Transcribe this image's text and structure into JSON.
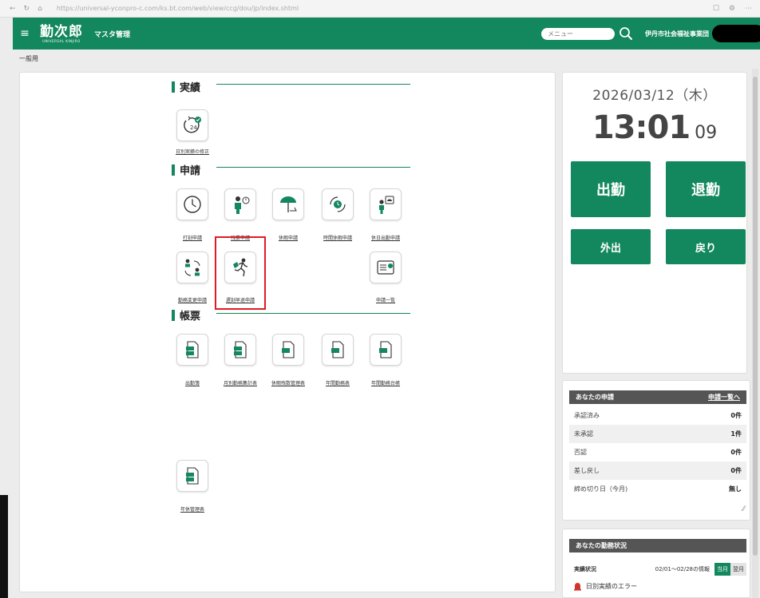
{
  "browser": {
    "url": "https://universal-yconpro-c.com/ks.bt.com/web/view/ccg/dou/jp/index.shtml"
  },
  "header": {
    "logo_main": "勤次郎",
    "logo_sub": "UNIVERSAL KINJIRO",
    "menu_label": "マスタ管理",
    "search_placeholder": "メニュー",
    "org_name": "伊丹市社会福祉事業団"
  },
  "breadcrumb": "一般用",
  "sections": [
    {
      "title": "実績"
    },
    {
      "title": "申請"
    },
    {
      "title": "帳票"
    }
  ],
  "tiles": [
    {
      "label": "日別実績の修正",
      "icon": "clock-24-check-icon"
    },
    {
      "label": "打刻申請",
      "icon": "wall-clock-icon"
    },
    {
      "label": "残業申請",
      "icon": "overtime-person-icon"
    },
    {
      "label": "休暇申請",
      "icon": "beach-umbrella-icon"
    },
    {
      "label": "時間休暇申請",
      "icon": "hourly-leave-icon"
    },
    {
      "label": "休日出勤申請",
      "icon": "holiday-work-person-icon"
    },
    {
      "label": "勤務変更申請",
      "icon": "shift-swap-icon"
    },
    {
      "label": "遅刻早退申請",
      "icon": "running-person-icon"
    },
    {
      "label": "申請一覧",
      "icon": "request-list-icon"
    },
    {
      "label": "出勤簿",
      "icon": "xls-pdf-icon"
    },
    {
      "label": "月別勤務集計表",
      "icon": "xls-pdf-icon"
    },
    {
      "label": "休暇残数管理表",
      "icon": "xls-icon"
    },
    {
      "label": "年間勤務表",
      "icon": "xls-icon"
    },
    {
      "label": "年間勤務台帳",
      "icon": "xls-icon"
    },
    {
      "label": "年休管理表",
      "icon": "xls-pdf-icon"
    }
  ],
  "clock": {
    "date": "2026/03/12（木）",
    "time": "13:01",
    "seconds": "09"
  },
  "punch": {
    "clock_in": "出勤",
    "clock_out": "退勤",
    "go_out": "外出",
    "return": "戻り"
  },
  "requests": {
    "title": "あなたの申請",
    "link": "申請一覧へ",
    "rows": [
      {
        "label": "承認済み",
        "value": "0件"
      },
      {
        "label": "未承認",
        "value": "1件"
      },
      {
        "label": "否認",
        "value": "0件"
      },
      {
        "label": "差し戻し",
        "value": "0件"
      },
      {
        "label": "締め切り日（今月)",
        "value": "無し"
      }
    ]
  },
  "status": {
    "title": "あなたの勤務状況",
    "label": "実績状況",
    "period": "02/01～02/28の情報",
    "this_month": "当月",
    "next_month": "翌月",
    "error_text": "日別実績のエラー"
  },
  "colors": {
    "brand": "#13875e",
    "highlight": "#e01b24"
  }
}
